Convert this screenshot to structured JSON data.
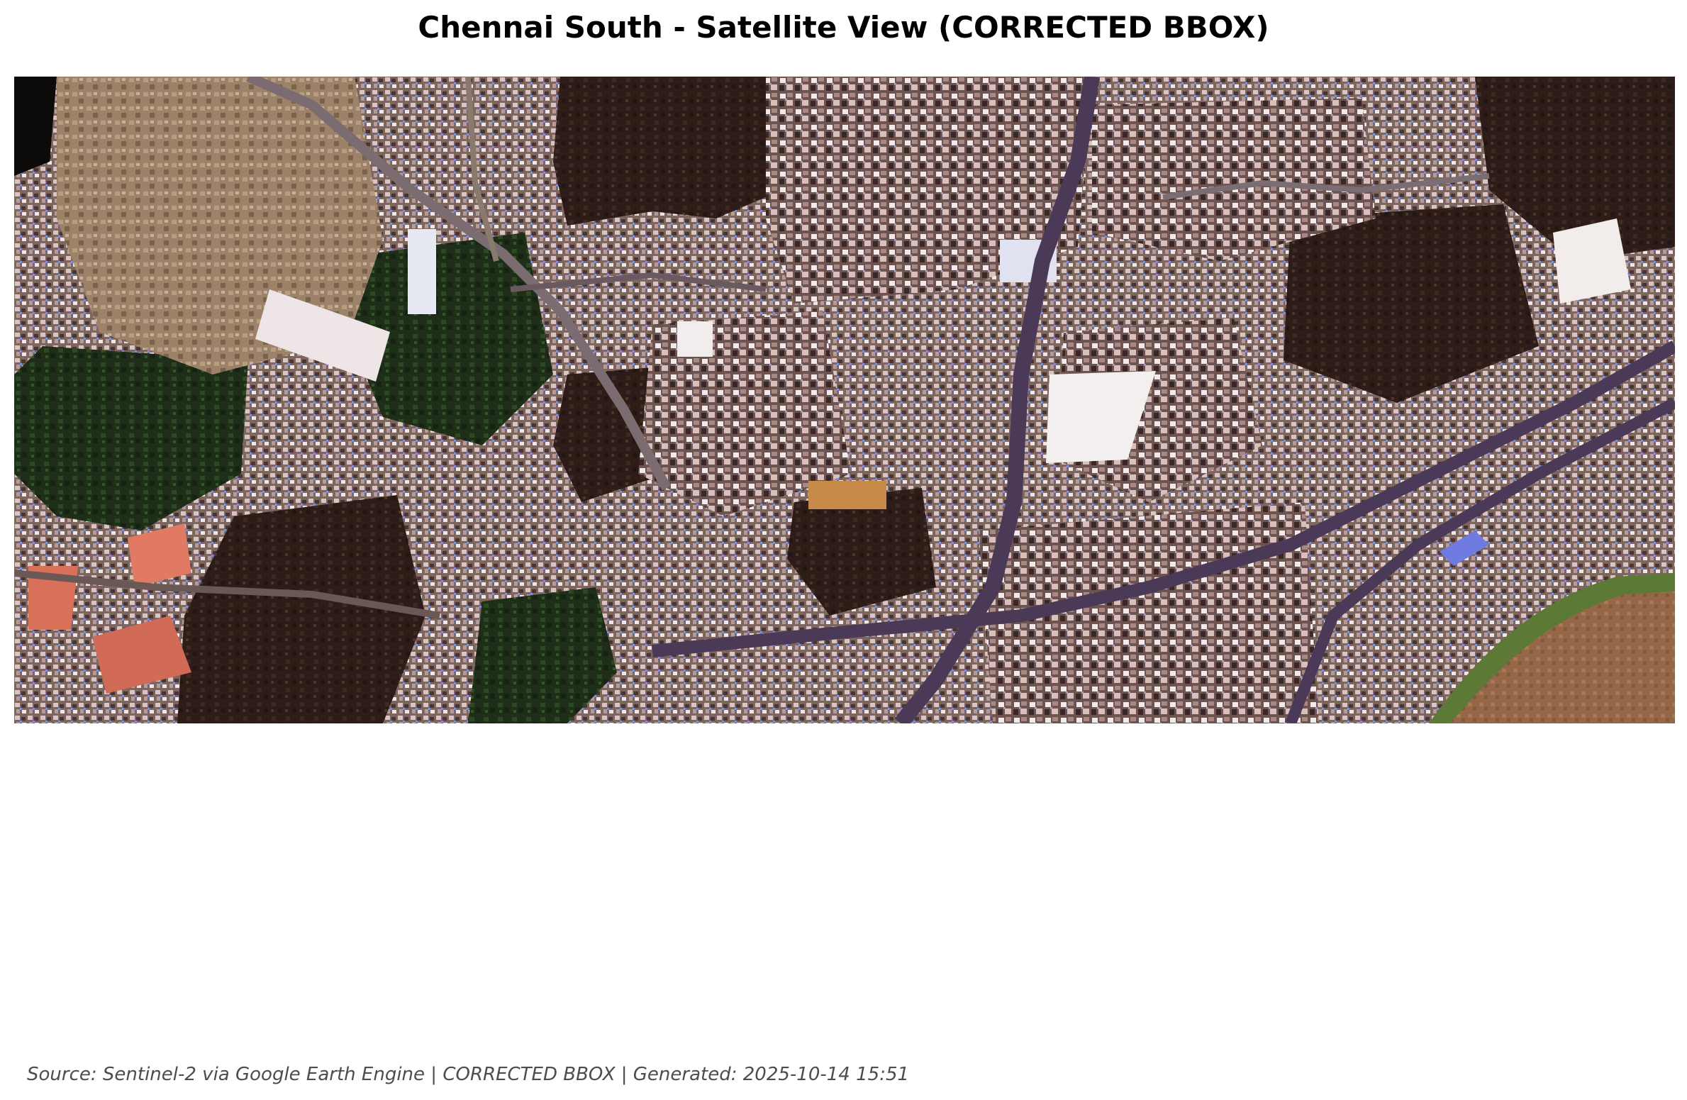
{
  "figure": {
    "title": "Chennai South - Satellite View (CORRECTED BBOX)",
    "source_note": "Source: Sentinel-2 via Google Earth Engine | CORRECTED BBOX | Generated: 2025-10-14 15:51"
  },
  "map": {
    "imagery": "true-color satellite image",
    "colors": {
      "urban": "#8a6f6a",
      "vegetation": "#1f3a1c",
      "dark_soil": "#2e1f1a",
      "road": "#4a3a55",
      "bare_ground": "#a48a6e",
      "racecourse": "#9a6a48",
      "racecourse_rim": "#5a7a3a"
    }
  }
}
